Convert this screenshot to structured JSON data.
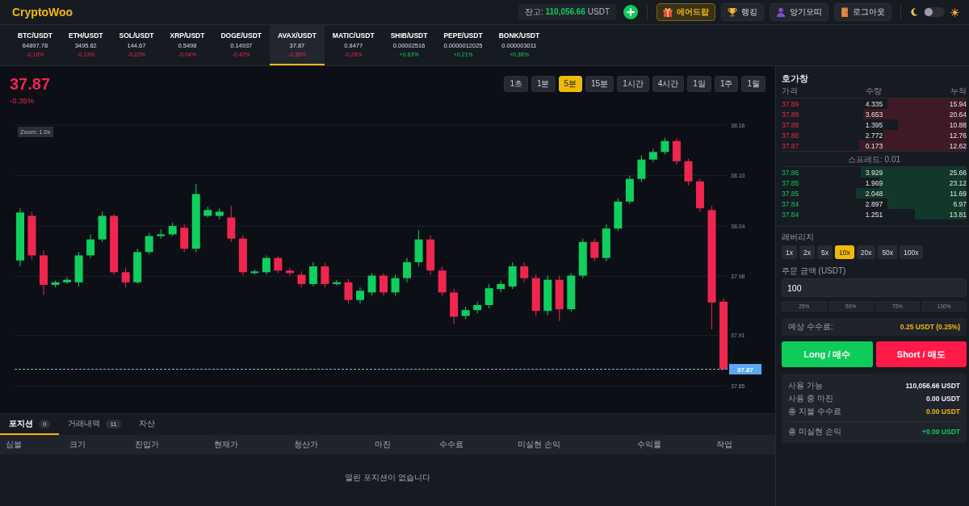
{
  "header": {
    "logo": "CryptoWoo",
    "balance": {
      "label": "잔고:",
      "amount": "110,056.66",
      "unit": "USDT"
    },
    "nav_buttons": [
      {
        "label": "에어드랍",
        "highlighted": true
      },
      {
        "label": "랭킹",
        "highlighted": false
      },
      {
        "label": "앙기모띠",
        "highlighted": false
      },
      {
        "label": "로그아웃",
        "highlighted": false
      }
    ],
    "theme_toggle": {
      "on": false
    }
  },
  "tickers": [
    {
      "symbol": "BTC/USDT",
      "price": "64897.78",
      "change": "-0.16%",
      "up": false,
      "selected": false
    },
    {
      "symbol": "ETH/USDT",
      "price": "3495.62",
      "change": "-0.13%",
      "up": false,
      "selected": false
    },
    {
      "symbol": "SOL/USDT",
      "price": "144.67",
      "change": "-0.22%",
      "up": false,
      "selected": false
    },
    {
      "symbol": "XRP/USDT",
      "price": "0.5498",
      "change": "-0.04%",
      "up": false,
      "selected": false
    },
    {
      "symbol": "DOGE/USDT",
      "price": "0.14937",
      "change": "-0.42%",
      "up": false,
      "selected": false
    },
    {
      "symbol": "AVAX/USDT",
      "price": "37.87",
      "change": "-0.35%",
      "up": false,
      "selected": true
    },
    {
      "symbol": "MATIC/USDT",
      "price": "0.8477",
      "change": "-0.28%",
      "up": false,
      "selected": false
    },
    {
      "symbol": "SHIB/USDT",
      "price": "0.00002516",
      "change": "+0.63%",
      "up": true,
      "selected": false
    },
    {
      "symbol": "PEPE/USDT",
      "price": "0.0000012025",
      "change": "+0.21%",
      "up": true,
      "selected": false
    },
    {
      "symbol": "BONK/USDT",
      "price": "0.000003011",
      "change": "+0.38%",
      "up": true,
      "selected": false
    }
  ],
  "chart": {
    "price": "37.87",
    "change": "-0.35%",
    "up": false,
    "timeframes": [
      {
        "label": "1초",
        "selected": false
      },
      {
        "label": "1분",
        "selected": false
      },
      {
        "label": "5분",
        "selected": true
      },
      {
        "label": "15분",
        "selected": false
      },
      {
        "label": "1시간",
        "selected": false
      },
      {
        "label": "4시간",
        "selected": false
      },
      {
        "label": "1일",
        "selected": false
      },
      {
        "label": "1주",
        "selected": false
      },
      {
        "label": "1월",
        "selected": false
      }
    ],
    "zoom_label": "Zoom: 1.0x",
    "chart_data": {
      "type": "candlestick",
      "ohlc": [
        [
          37.999,
          38.061,
          37.992,
          38.056
        ],
        [
          38.052,
          38.057,
          38.0,
          38.005
        ],
        [
          38.005,
          38.011,
          37.958,
          37.97
        ],
        [
          37.97,
          37.975,
          37.967,
          37.973
        ],
        [
          37.973,
          37.979,
          37.971,
          37.976
        ],
        [
          37.973,
          38.009,
          37.968,
          38.005
        ],
        [
          38.005,
          38.03,
          38.002,
          38.024
        ],
        [
          38.024,
          38.057,
          38.021,
          38.052
        ],
        [
          38.052,
          38.054,
          37.982,
          37.985
        ],
        [
          37.985,
          37.99,
          37.967,
          37.973
        ],
        [
          37.973,
          38.013,
          37.971,
          38.009
        ],
        [
          38.009,
          38.032,
          38.006,
          38.028
        ],
        [
          38.028,
          38.036,
          38.025,
          38.03
        ],
        [
          38.03,
          38.044,
          38.028,
          38.04
        ],
        [
          38.038,
          38.042,
          38.009,
          38.013
        ],
        [
          38.013,
          38.09,
          38.009,
          38.078
        ],
        [
          38.052,
          38.063,
          38.05,
          38.059
        ],
        [
          38.052,
          38.061,
          38.048,
          38.057
        ],
        [
          38.05,
          38.064,
          38.021,
          38.025
        ],
        [
          38.025,
          38.029,
          37.981,
          37.985
        ],
        [
          37.984,
          37.988,
          37.982,
          37.986
        ],
        [
          37.985,
          38.005,
          37.982,
          38.002
        ],
        [
          38.002,
          38.004,
          37.984,
          37.987
        ],
        [
          37.987,
          37.99,
          37.981,
          37.984
        ],
        [
          37.982,
          37.986,
          37.967,
          37.971
        ],
        [
          37.971,
          37.997,
          37.968,
          37.992
        ],
        [
          37.992,
          37.996,
          37.967,
          37.971
        ],
        [
          37.971,
          37.976,
          37.969,
          37.973
        ],
        [
          37.973,
          37.977,
          37.948,
          37.952
        ],
        [
          37.952,
          37.967,
          37.948,
          37.963
        ],
        [
          37.961,
          37.984,
          37.957,
          37.981
        ],
        [
          37.981,
          37.984,
          37.957,
          37.961
        ],
        [
          37.961,
          37.982,
          37.957,
          37.978
        ],
        [
          37.978,
          38.002,
          37.973,
          37.997
        ],
        [
          37.997,
          38.035,
          37.992,
          38.024
        ],
        [
          38.024,
          38.029,
          37.982,
          37.987
        ],
        [
          37.987,
          37.992,
          37.957,
          37.961
        ],
        [
          37.961,
          37.965,
          37.923,
          37.932
        ],
        [
          37.933,
          37.944,
          37.929,
          37.94
        ],
        [
          37.94,
          37.95,
          37.936,
          37.946
        ],
        [
          37.946,
          37.971,
          37.942,
          37.966
        ],
        [
          37.965,
          37.975,
          37.961,
          37.971
        ],
        [
          37.968,
          37.997,
          37.965,
          37.992
        ],
        [
          37.992,
          37.997,
          37.973,
          37.978
        ],
        [
          37.978,
          37.982,
          37.933,
          37.939
        ],
        [
          37.939,
          37.981,
          37.934,
          37.976
        ],
        [
          37.976,
          37.981,
          37.927,
          37.941
        ],
        [
          37.941,
          37.984,
          37.938,
          37.981
        ],
        [
          37.981,
          38.025,
          37.978,
          38.021
        ],
        [
          38.021,
          38.025,
          37.998,
          38.002
        ],
        [
          38.002,
          38.042,
          37.998,
          38.037
        ],
        [
          38.037,
          38.073,
          38.034,
          38.069
        ],
        [
          38.069,
          38.1,
          38.066,
          38.096
        ],
        [
          38.096,
          38.124,
          38.092,
          38.119
        ],
        [
          38.119,
          38.132,
          38.116,
          38.128
        ],
        [
          38.128,
          38.145,
          38.125,
          38.141
        ],
        [
          38.141,
          38.144,
          38.113,
          38.117
        ],
        [
          38.117,
          38.12,
          38.088,
          38.093
        ],
        [
          38.093,
          38.096,
          38.057,
          38.061
        ],
        [
          38.059,
          38.064,
          37.917,
          37.949
        ],
        [
          37.95,
          37.954,
          37.868,
          37.87
        ]
      ],
      "ylim": [
        37.85,
        38.16
      ],
      "yticks": [
        {
          "value": 38.16,
          "label": "38.16"
        },
        {
          "value": 38.1,
          "label": "38.10"
        },
        {
          "value": 38.04,
          "label": "38.04"
        },
        {
          "value": 37.98,
          "label": "37.98"
        },
        {
          "value": 37.91,
          "label": "37.91"
        },
        {
          "value": 37.85,
          "label": "37.85"
        }
      ],
      "grid": true,
      "ref_lines": [
        {
          "axis": "y",
          "value": 37.87,
          "label": "37.87",
          "color": "#7fb2e0"
        }
      ]
    }
  },
  "positions": {
    "tabs": [
      {
        "label": "포지션",
        "count": "0",
        "selected": true
      },
      {
        "label": "거래내역",
        "count": "11",
        "selected": false
      },
      {
        "label": "자산",
        "selected": false
      }
    ],
    "columns": [
      "심볼",
      "크기",
      "진입가",
      "현재가",
      "청산가",
      "마진",
      "수수료",
      "미실현 손익",
      "수익률",
      "작업"
    ],
    "empty_message": "열린 포지션이 없습니다"
  },
  "order_book": {
    "title": "호가창",
    "columns": [
      "가격",
      "수량",
      "누적"
    ],
    "asks": [
      {
        "price": "37.89",
        "amount": "4.335",
        "total": "15.94",
        "level": 0.43
      },
      {
        "price": "37.89",
        "amount": "3.653",
        "total": "20.64",
        "level": 0.56
      },
      {
        "price": "37.88",
        "amount": "1.395",
        "total": "10.88",
        "level": 0.37
      },
      {
        "price": "37.88",
        "amount": "2.772",
        "total": "12.76",
        "level": 0.45
      },
      {
        "price": "37.87",
        "amount": "0.173",
        "total": "12.62",
        "level": 0.58
      }
    ],
    "spread": "스프레드: 0.01",
    "bids": [
      {
        "price": "37.86",
        "amount": "3.929",
        "total": "25.66",
        "level": 0.57
      },
      {
        "price": "37.85",
        "amount": "1.969",
        "total": "23.12",
        "level": 0.47
      },
      {
        "price": "37.85",
        "amount": "2.048",
        "total": "11.69",
        "level": 0.6
      },
      {
        "price": "37.84",
        "amount": "2.897",
        "total": "6.97",
        "level": 0.43
      },
      {
        "price": "37.84",
        "amount": "1.251",
        "total": "13.81",
        "level": 0.28
      }
    ]
  },
  "order_form": {
    "leverage": {
      "label": "레버리지",
      "options": [
        {
          "label": "1x",
          "selected": false
        },
        {
          "label": "2x",
          "selected": false
        },
        {
          "label": "5x",
          "selected": false
        },
        {
          "label": "10x",
          "selected": true
        },
        {
          "label": "20x",
          "selected": false
        },
        {
          "label": "50x",
          "selected": false
        },
        {
          "label": "100x",
          "selected": false
        }
      ]
    },
    "amount": {
      "label": "주문 금액 (USDT)",
      "value": "100"
    },
    "percent_buttons": [
      "25%",
      "50%",
      "75%",
      "100%"
    ],
    "fee": {
      "label": "예상 수수료:",
      "value": "0.25 USDT (0.25%)"
    },
    "actions": [
      {
        "kind": "long",
        "label": "Long / 매수"
      },
      {
        "kind": "short",
        "label": "Short / 매도"
      }
    ],
    "account": [
      {
        "label": "사용 가능",
        "value": "110,056.66 USDT",
        "color": "#eef0f4"
      },
      {
        "label": "사용 중 마진",
        "value": "0.00 USDT",
        "color": "#eef0f4"
      },
      {
        "label": "총 지불 수수료",
        "value": "0.00 USDT",
        "color": "#f0b90b"
      }
    ],
    "unrealized_pnl": {
      "label": "총 미실현 손익",
      "value": "+0.00 USDT",
      "color": "#0ecb5a"
    }
  }
}
